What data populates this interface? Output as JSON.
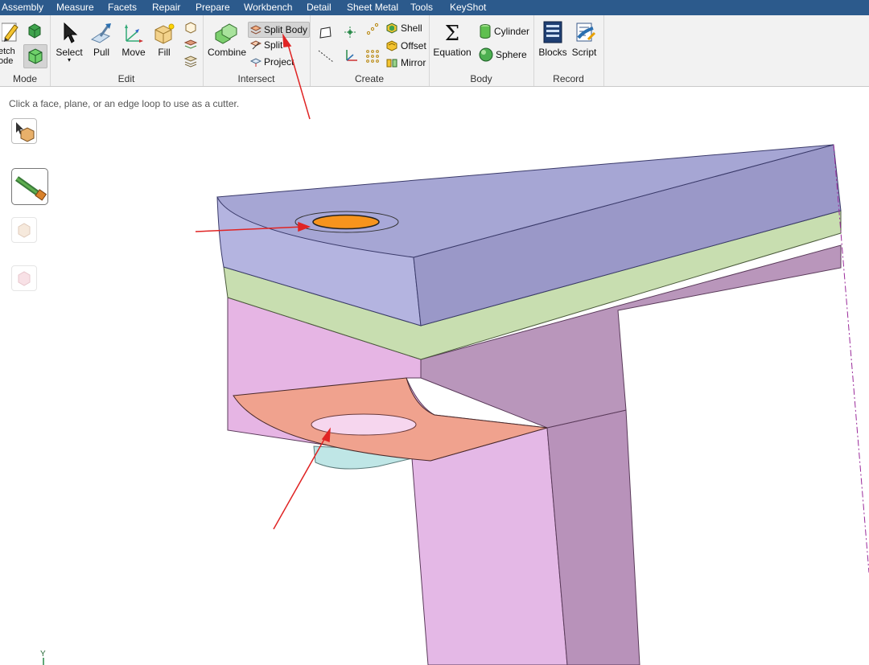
{
  "menu": [
    "Assembly",
    "Measure",
    "Facets",
    "Repair",
    "Prepare",
    "Workbench",
    "Detail",
    "Sheet Metal",
    "Tools",
    "KeyShot"
  ],
  "ribbon": {
    "mode": {
      "label": "Mode",
      "sketch_line1": "etch",
      "sketch_line2": "ode"
    },
    "edit": {
      "label": "Edit",
      "select": "Select",
      "pull": "Pull",
      "move": "Move",
      "fill": "Fill"
    },
    "intersect": {
      "label": "Intersect",
      "combine": "Combine",
      "split_body": "Split Body",
      "split": "Split",
      "project": "Project"
    },
    "create": {
      "label": "Create",
      "shell": "Shell",
      "offset": "Offset",
      "mirror": "Mirror"
    },
    "body": {
      "label": "Body",
      "equation": "Equation",
      "cylinder": "Cylinder",
      "sphere": "Sphere"
    },
    "record": {
      "label": "Record",
      "blocks": "Blocks",
      "script": "Script"
    }
  },
  "viewport": {
    "hint": "Click a face, plane, or an edge loop to use as a cutter.",
    "axis_label": "Y"
  },
  "colors": {
    "top_face": "#a3a3d6",
    "green_layer": "#c6dcb0",
    "pink_body": "#e3b4e1",
    "salmon_face": "#f0a690",
    "highlight_hole": "#f7941d",
    "annotation_arrow": "#e02424"
  }
}
